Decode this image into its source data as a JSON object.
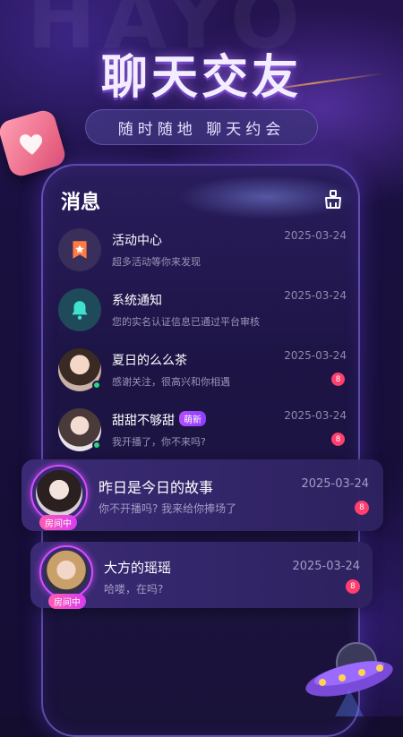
{
  "banner": {
    "watermark": "HAYO",
    "title": "聊天交友",
    "subtitle": "随时随地 聊天约会"
  },
  "messages": {
    "title": "消息",
    "clear_icon": "broom-icon",
    "items": [
      {
        "name": "活动中心",
        "preview": "超多活动等你来发现",
        "date": "2025-03-24",
        "avatar": "activity-icon"
      },
      {
        "name": "系统通知",
        "preview": "您的实名认证信息已通过平台审核",
        "date": "2025-03-24",
        "avatar": "bell-icon"
      },
      {
        "name": "夏日的么么茶",
        "preview": "感谢关注，很高兴和你相遇",
        "date": "2025-03-24",
        "count": "8",
        "online": true
      },
      {
        "name": "甜甜不够甜",
        "tag": "萌新",
        "preview": "我开播了，你不来吗?",
        "date": "2025-03-24",
        "count": "8",
        "online": true
      },
      {
        "name": "昨日是今日的故事",
        "preview": "你不开播吗? 我来给你捧场了",
        "date": "2025-03-24",
        "count": "8",
        "live": "房间中"
      },
      {
        "name": "大方的瑶瑶",
        "preview": "哈喽，在吗?",
        "date": "2025-03-24",
        "count": "8",
        "live": "房间中"
      }
    ]
  },
  "colors": {
    "accent": "#d84dff",
    "badge": "#ff3f6e",
    "online": "#27d77a"
  }
}
